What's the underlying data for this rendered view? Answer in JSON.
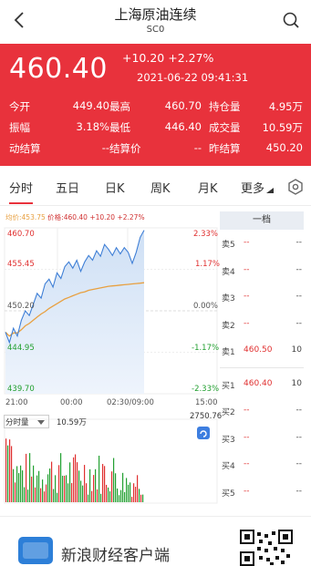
{
  "header": {
    "title": "上海原油连续",
    "subtitle": "SC0"
  },
  "quote": {
    "price": "460.40",
    "change": "+10.20 +2.27%",
    "time": "2021-06-22 09:41:31",
    "stats": [
      [
        {
          "label": "今开",
          "value": "449.40"
        },
        {
          "label": "最高",
          "value": "460.70"
        },
        {
          "label": "持仓量",
          "value": "4.95万"
        }
      ],
      [
        {
          "label": "振幅",
          "value": "3.18%"
        },
        {
          "label": "最低",
          "value": "446.40"
        },
        {
          "label": "成交量",
          "value": "10.59万"
        }
      ],
      [
        {
          "label": "动结算",
          "value": "--"
        },
        {
          "label": "结算价",
          "value": "--"
        },
        {
          "label": "昨结算",
          "value": "450.20"
        }
      ]
    ]
  },
  "tabs": [
    "分时",
    "五日",
    "日K",
    "周K",
    "月K",
    "更多"
  ],
  "active_tab": "分时",
  "chart": {
    "legend_avg": "均价:453.75",
    "legend_cur": "价格:460.40 +10.20 +2.27%",
    "y_labels_left": [
      "460.70",
      "455.45",
      "450.20",
      "444.95",
      "439.70"
    ],
    "y_labels_right": [
      "2.33%",
      "1.17%",
      "0.00%",
      "-1.17%",
      "-2.33%"
    ],
    "x_labels": [
      "21:00",
      "00:00",
      "02:30/09:00",
      "15:00"
    ],
    "volume_label": "分时量",
    "volume_value": "10.59万",
    "volume_max": "2750.76"
  },
  "chart_data": {
    "type": "line",
    "ylim": [
      439.7,
      460.7
    ],
    "series": [
      {
        "values": [
          447.5,
          446.2,
          448.0,
          447.0,
          449.0,
          450.2,
          449.6,
          451.0,
          452.4,
          451.8,
          453.6,
          454.2,
          453.2,
          455.0,
          454.3,
          455.8,
          456.4,
          455.6,
          456.6,
          455.2,
          456.4,
          457.2,
          456.6,
          457.8,
          457.1,
          458.6,
          458.0,
          457.2,
          458.2,
          457.4,
          458.2,
          457.6,
          456.2,
          457.6,
          459.5,
          460.4
        ]
      },
      {
        "values": [
          447.5,
          447.0,
          447.4,
          447.4,
          447.8,
          448.3,
          448.6,
          449.0,
          449.4,
          449.8,
          450.1,
          450.5,
          450.8,
          451.1,
          451.4,
          451.7,
          451.9,
          452.1,
          452.3,
          452.5,
          452.6,
          452.8,
          452.9,
          453.0,
          453.1,
          453.2,
          453.3,
          453.35,
          453.4,
          453.45,
          453.5,
          453.55,
          453.6,
          453.65,
          453.7,
          453.75
        ]
      }
    ]
  },
  "order_book": {
    "title": "一档",
    "asks": [
      {
        "label": "卖5",
        "price": "--",
        "vol": "--"
      },
      {
        "label": "卖4",
        "price": "--",
        "vol": "--"
      },
      {
        "label": "卖3",
        "price": "--",
        "vol": "--"
      },
      {
        "label": "卖2",
        "price": "--",
        "vol": "--"
      },
      {
        "label": "卖1",
        "price": "460.50",
        "vol": "10"
      }
    ],
    "bids": [
      {
        "label": "买1",
        "price": "460.40",
        "vol": "10"
      },
      {
        "label": "买2",
        "price": "--",
        "vol": "--"
      },
      {
        "label": "买3",
        "price": "--",
        "vol": "--"
      },
      {
        "label": "买4",
        "price": "--",
        "vol": "--"
      },
      {
        "label": "买5",
        "price": "--",
        "vol": "--"
      }
    ]
  },
  "footer": {
    "app_name": "新浪财经客户端"
  },
  "colors": {
    "accent": "#e8323c",
    "price_line": "#3f7fd6",
    "avg_line": "#e8a040",
    "up": "#e03030",
    "down": "#22a030"
  },
  "icons": {
    "back": "chevron-left-icon",
    "search": "search-icon",
    "settings": "gear-icon",
    "refresh": "refresh-icon"
  }
}
